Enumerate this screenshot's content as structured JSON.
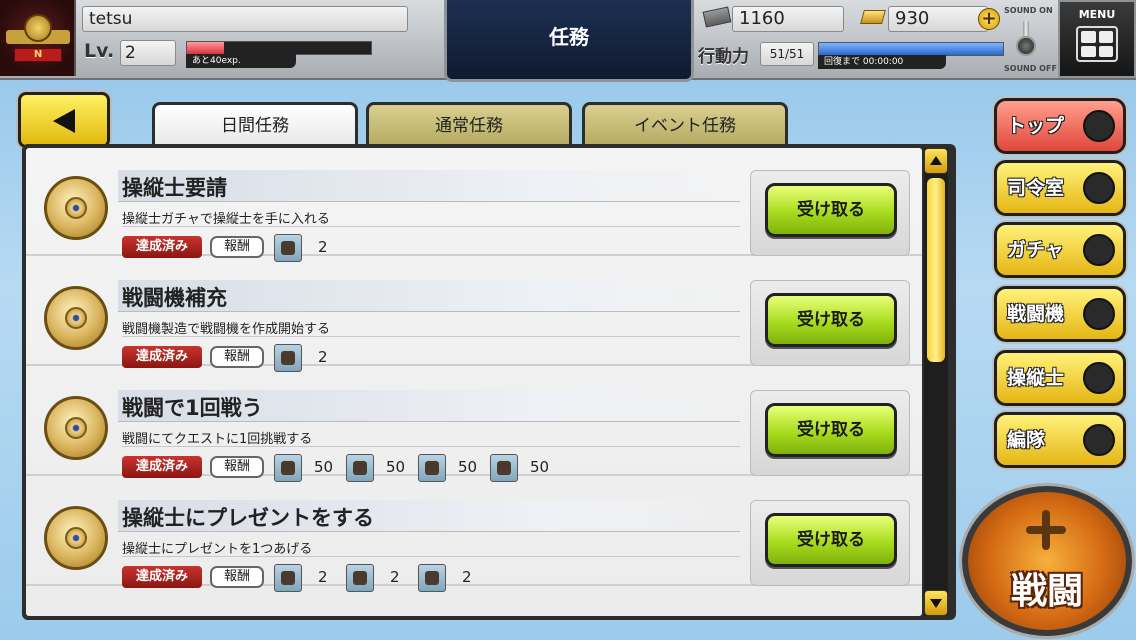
{
  "header": {
    "player_name": "tetsu",
    "level_label": "Lv.",
    "level": "2",
    "exp_text": "あと40exp.",
    "exp_fraction": 0.2,
    "screen_title": "任務",
    "money": "1160",
    "gold": "930",
    "plus_label": "+",
    "action_label": "行動力",
    "action_value": "51/51",
    "recover_text": "回復まで 00:00:00",
    "recover_fraction": 1.0,
    "sound_on_label": "SOUND ON",
    "sound_off_label": "SOUND OFF",
    "menu_label": "MENU",
    "emblem_text": "N"
  },
  "tabs": [
    {
      "label": "日間任務",
      "active": true
    },
    {
      "label": "通常任務",
      "active": false
    },
    {
      "label": "イベント任務",
      "active": false
    }
  ],
  "missions": [
    {
      "title": "操縦士要請",
      "desc": "操縦士ガチャで操縦士を手に入れる",
      "status": "達成済み",
      "reward_label": "報酬",
      "rewards": [
        {
          "icon": "pilot-card-icon",
          "count": "2"
        }
      ],
      "claim_label": "受け取る"
    },
    {
      "title": "戦闘機補充",
      "desc": "戦闘機製造で戦闘機を作成開始する",
      "status": "達成済み",
      "reward_label": "報酬",
      "rewards": [
        {
          "icon": "pilot-card-icon",
          "count": "2"
        }
      ],
      "claim_label": "受け取る"
    },
    {
      "title": "戦闘で1回戦う",
      "desc": "戦闘にてクエストに1回挑戦する",
      "status": "達成済み",
      "reward_label": "報酬",
      "rewards": [
        {
          "icon": "material-gear-icon",
          "count": "50"
        },
        {
          "icon": "material-crate-icon",
          "count": "50"
        },
        {
          "icon": "material-parts-icon",
          "count": "50"
        },
        {
          "icon": "material-box-icon",
          "count": "50"
        }
      ],
      "claim_label": "受け取る"
    },
    {
      "title": "操縦士にプレゼントをする",
      "desc": "操縦士にプレゼントを1つあげる",
      "status": "達成済み",
      "reward_label": "報酬",
      "rewards": [
        {
          "icon": "gift-key-icon",
          "count": "2"
        },
        {
          "icon": "gift-candy-icon",
          "count": "2"
        },
        {
          "icon": "gift-bottle-icon",
          "count": "2"
        }
      ],
      "claim_label": "受け取る"
    }
  ],
  "nav": [
    {
      "label": "トップ",
      "icon": "base-building-icon"
    },
    {
      "label": "司令室",
      "icon": "globe-icon"
    },
    {
      "label": "ガチャ",
      "icon": "card-sparkle-icon"
    },
    {
      "label": "戦闘機",
      "icon": "fighter-plane-icon"
    },
    {
      "label": "操縦士",
      "icon": "pilot-goggles-icon"
    },
    {
      "label": "編隊",
      "icon": "formation-planes-icon"
    }
  ],
  "battle_label": "戦闘",
  "colors": {
    "claim_green": "#a8dc1d",
    "status_red": "#b0241f",
    "nav_yellow": "#f3cf3a",
    "nav_top_red": "#e0473b",
    "title_panel": "#1c2f52"
  }
}
